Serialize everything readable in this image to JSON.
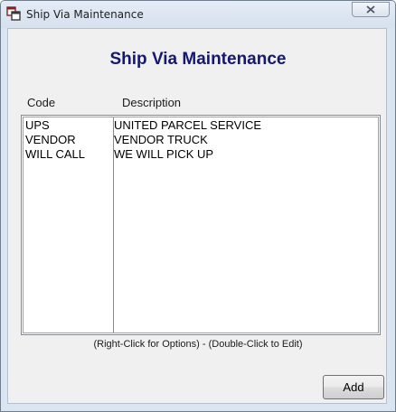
{
  "window": {
    "title": "Ship Via Maintenance"
  },
  "main": {
    "heading": "Ship Via Maintenance",
    "columns": {
      "code": "Code",
      "description": "Description"
    },
    "rows": [
      {
        "code": "UPS",
        "description": "UNITED PARCEL SERVICE"
      },
      {
        "code": "VENDOR",
        "description": "VENDOR TRUCK"
      },
      {
        "code": "WILL CALL",
        "description": "WE WILL PICK UP"
      }
    ],
    "hint": "(Right-Click for Options) - (Double-Click to Edit)",
    "add_label": "Add"
  },
  "colors": {
    "heading": "#141870",
    "dialog_background": "#f0f0f0",
    "frame": "#dbe5f1"
  },
  "icons": {
    "app": "window-app-icon",
    "close": "close-icon"
  }
}
